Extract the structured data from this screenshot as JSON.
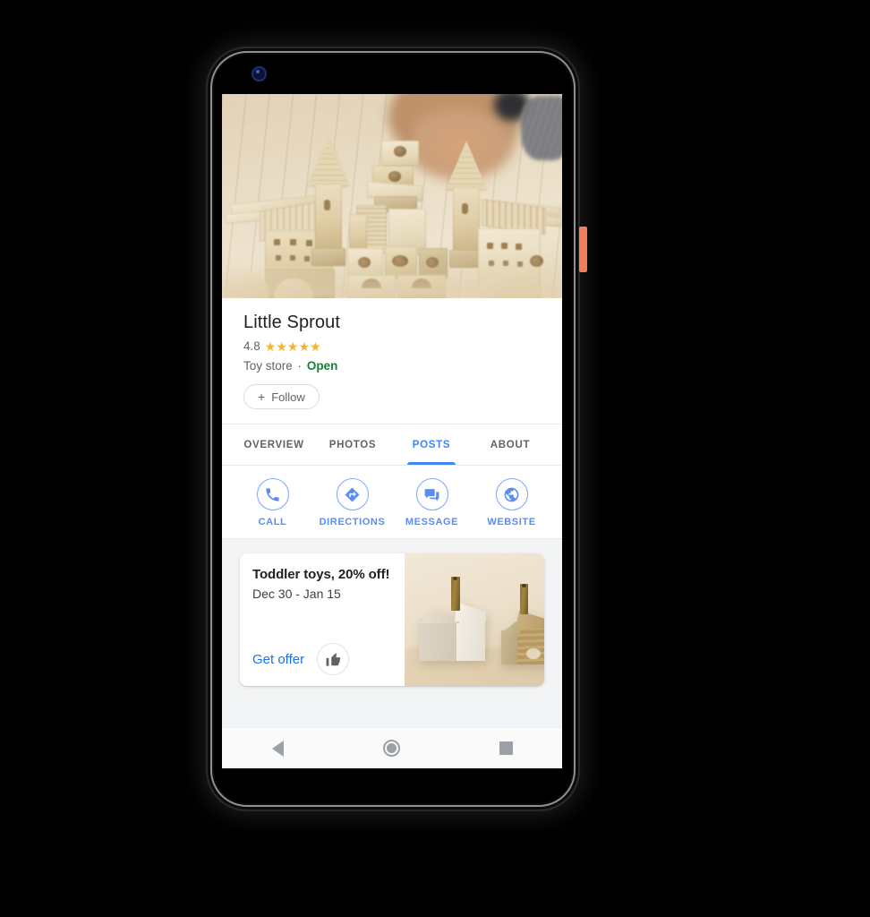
{
  "device": {
    "type": "android-phone",
    "power_button_color": "#ef7f5e",
    "camera": "front-camera-punch-hole"
  },
  "app": {
    "accent_color": "#4285f4",
    "link_color": "#1a73e8",
    "open_color": "#188038",
    "star_color": "#f2b42c"
  },
  "hero": {
    "alt": "wooden-block-castle-photo"
  },
  "business": {
    "name": "Little Sprout",
    "rating": "4.8",
    "stars": [
      "★",
      "★",
      "★",
      "★",
      "★"
    ],
    "category": "Toy store",
    "separator": "·",
    "status": "Open",
    "follow_label": "Follow",
    "follow_plus": "+"
  },
  "tabs": [
    {
      "label": "OVERVIEW",
      "active": false
    },
    {
      "label": "PHOTOS",
      "active": false
    },
    {
      "label": "POSTS",
      "active": true
    },
    {
      "label": "ABOUT",
      "active": false
    }
  ],
  "actions": [
    {
      "label": "CALL",
      "icon": "phone-icon"
    },
    {
      "label": "DIRECTIONS",
      "icon": "directions-icon"
    },
    {
      "label": "MESSAGE",
      "icon": "message-icon"
    },
    {
      "label": "WEBSITE",
      "icon": "globe-icon"
    }
  ],
  "post": {
    "title": "Toddler toys, 20% off!",
    "date_range": "Dec 30 - Jan 15",
    "cta_label": "Get offer",
    "like_icon": "thumbs-up-icon",
    "photo_alt": "wooden-house-toys-photo"
  },
  "navbar": {
    "back": "back-triangle-icon",
    "home": "home-circle-icon",
    "recents": "recents-square-icon"
  }
}
